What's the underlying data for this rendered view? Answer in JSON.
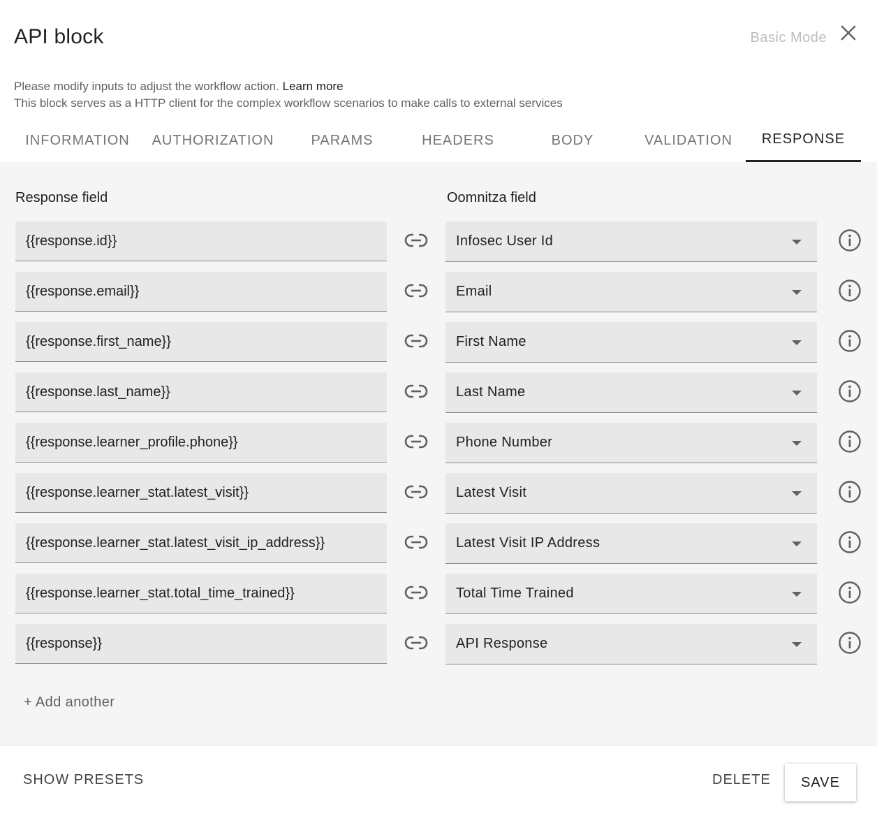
{
  "dialog": {
    "title": "API block",
    "basic_mode_label": "Basic Mode",
    "description_line1": "Please modify inputs to adjust the workflow action.",
    "learn_more": "Learn more",
    "description_line2": "This block serves as a HTTP client for the complex workflow scenarios to make calls to external services"
  },
  "tabs": [
    {
      "label": "INFORMATION",
      "active": false
    },
    {
      "label": "AUTHORIZATION",
      "active": false
    },
    {
      "label": "PARAMS",
      "active": false
    },
    {
      "label": "HEADERS",
      "active": false
    },
    {
      "label": "BODY",
      "active": false
    },
    {
      "label": "VALIDATION",
      "active": false
    },
    {
      "label": "RESPONSE",
      "active": true
    }
  ],
  "response": {
    "response_field_label": "Response field",
    "oomnitza_field_label": "Oomnitza field",
    "rows": [
      {
        "response_field": "{{response.id}}",
        "oomnitza_field": "Infosec User Id"
      },
      {
        "response_field": "{{response.email}}",
        "oomnitza_field": "Email"
      },
      {
        "response_field": "{{response.first_name}}",
        "oomnitza_field": "First Name"
      },
      {
        "response_field": "{{response.last_name}}",
        "oomnitza_field": "Last Name"
      },
      {
        "response_field": "{{response.learner_profile.phone}}",
        "oomnitza_field": "Phone Number"
      },
      {
        "response_field": "{{response.learner_stat.latest_visit}}",
        "oomnitza_field": "Latest Visit"
      },
      {
        "response_field": "{{response.learner_stat.latest_visit_ip_address}}",
        "oomnitza_field": "Latest Visit IP Address"
      },
      {
        "response_field": "{{response.learner_stat.total_time_trained}}",
        "oomnitza_field": "Total Time Trained"
      },
      {
        "response_field": "{{response}}",
        "oomnitza_field": "API Response"
      }
    ],
    "add_another_label": "+ Add another"
  },
  "footer": {
    "show_presets_label": "SHOW PRESETS",
    "delete_label": "DELETE",
    "save_label": "SAVE"
  },
  "icons": {
    "close": "close-icon",
    "link": "link-icon",
    "info": "info-icon",
    "dropdown": "chevron-down-icon"
  }
}
